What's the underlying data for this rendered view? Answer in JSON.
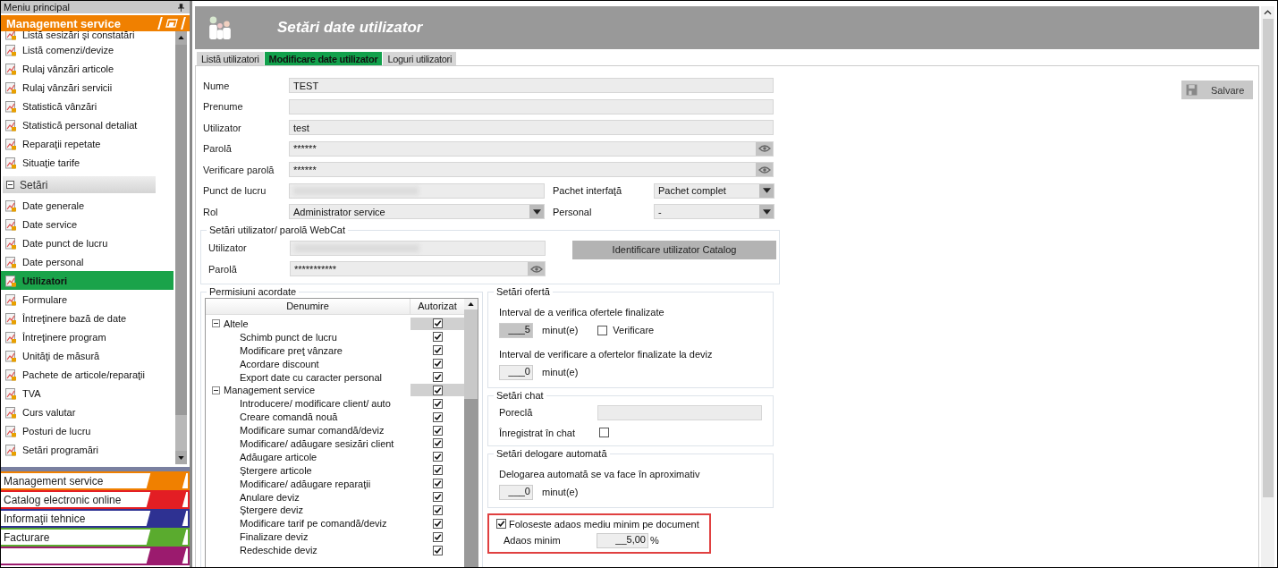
{
  "sidebar": {
    "title": "Meniu principal",
    "header": "Management service",
    "items": [
      {
        "label": "Listă sesizări şi constatări",
        "selected": false
      },
      {
        "label": "Listă comenzi/devize",
        "selected": false
      },
      {
        "label": "Rulaj vânzări articole",
        "selected": false
      },
      {
        "label": "Rulaj vânzări servicii",
        "selected": false
      },
      {
        "label": "Statistică vânzări",
        "selected": false
      },
      {
        "label": "Statistică personal detaliat",
        "selected": false
      },
      {
        "label": "Reparaţii repetate",
        "selected": false
      },
      {
        "label": "Situaţie tarife",
        "selected": false
      }
    ],
    "group": {
      "label": "Setări",
      "expanded": true
    },
    "group_items": [
      {
        "label": "Date generale",
        "selected": false
      },
      {
        "label": "Date service",
        "selected": false
      },
      {
        "label": "Date punct de lucru",
        "selected": false
      },
      {
        "label": "Date personal",
        "selected": false
      },
      {
        "label": "Utilizatori",
        "selected": true
      },
      {
        "label": "Formulare",
        "selected": false
      },
      {
        "label": "Întreţinere bază de date",
        "selected": false
      },
      {
        "label": "Întreţinere program",
        "selected": false
      },
      {
        "label": "Unităţi de măsură",
        "selected": false
      },
      {
        "label": "Pachete de articole/reparaţii",
        "selected": false
      },
      {
        "label": "TVA",
        "selected": false
      },
      {
        "label": "Curs valutar",
        "selected": false
      },
      {
        "label": "Posturi de lucru",
        "selected": false
      },
      {
        "label": "Setări programări",
        "selected": false
      }
    ],
    "nav_sections": [
      {
        "label": "Management service",
        "color": "#f08000"
      },
      {
        "label": "Catalog electronic online",
        "color": "#e31e24"
      },
      {
        "label": "Informaţii tehnice",
        "color": "#2e3192"
      },
      {
        "label": "Facturare",
        "color": "#5aab2e"
      },
      {
        "color": "#9b1b6e"
      }
    ]
  },
  "header": {
    "title": "Setări date utilizator"
  },
  "tabs": [
    {
      "label": "Listă utilizatori",
      "selected": false
    },
    {
      "label": "Modificare date utilizator",
      "selected": true
    },
    {
      "label": "Loguri utilizatori",
      "selected": false
    }
  ],
  "fields": [
    {
      "label": "Nume",
      "value": "TEST",
      "kind": "text"
    },
    {
      "label": "Prenume",
      "kind": "text"
    },
    {
      "label": "Utilizator",
      "value": "test",
      "kind": "text"
    },
    {
      "label": "Parolă",
      "value": "******",
      "kind": "password"
    },
    {
      "label": "Verificare parolă",
      "value": "******",
      "kind": "password"
    },
    {
      "label": "Punct de lucru",
      "kind": "blurred",
      "side": {
        "label": "Pachet interfaţă",
        "value": "Pachet complet"
      }
    },
    {
      "label": "Rol",
      "value": "Administrator service",
      "kind": "select",
      "side": {
        "label": "Personal",
        "value": "-"
      }
    }
  ],
  "webcat": {
    "title": "Setări utilizator/ parolă WebCat",
    "fields": [
      {
        "label": "Utilizator",
        "kind": "blurred"
      },
      {
        "label": "Parolă",
        "value": "***********",
        "kind": "password"
      }
    ],
    "button": "Identificare utilizator Catalog"
  },
  "permissions": {
    "title": "Permisiuni acordate",
    "columns": [
      "Denumire",
      "Autorizat"
    ],
    "rows": [
      {
        "label": "Altele",
        "expanded": true,
        "checked": true,
        "children": [
          {
            "label": "Schimb punct de lucru",
            "checked": true
          },
          {
            "label": "Modificare preţ vânzare",
            "checked": true
          },
          {
            "label": "Acordare discount",
            "checked": true
          },
          {
            "label": "Export date cu caracter personal",
            "checked": true
          }
        ]
      },
      {
        "label": "Management service",
        "expanded": true,
        "checked": true,
        "children": [
          {
            "label": "Introducere/ modificare client/ auto",
            "checked": true
          },
          {
            "label": "Creare comandă nouă",
            "checked": true
          },
          {
            "label": "Modificare sumar comandă/deviz",
            "checked": true
          },
          {
            "label": "Modificare/ adăugare sesizări client",
            "checked": true
          },
          {
            "label": "Adăugare articole",
            "checked": true
          },
          {
            "label": "Ştergere articole",
            "checked": true
          },
          {
            "label": "Modificare/ adăugare reparaţii",
            "checked": true
          },
          {
            "label": "Anulare deviz",
            "checked": true
          },
          {
            "label": "Ştergere deviz",
            "checked": true
          },
          {
            "label": "Modificare tarif pe comandă/deviz",
            "checked": true
          },
          {
            "label": "Finalizare deviz",
            "checked": true
          },
          {
            "label": "Redeschide deviz",
            "checked": true
          }
        ]
      }
    ]
  },
  "offer": {
    "title": "Setări ofertă",
    "intervals": [
      {
        "label": "Interval de a verifica ofertele finalizate",
        "value": "___5",
        "unit": "minut(e)",
        "disabled": true,
        "verify": {
          "label": "Verificare",
          "checked": false
        }
      },
      {
        "label": "Interval de verificare a ofertelor finalizate la deviz",
        "value": "___0",
        "unit": "minut(e)",
        "disabled": false
      }
    ]
  },
  "chat": {
    "title": "Setări chat",
    "nickname_label": "Poreclă",
    "registered": {
      "label": "Înregistrat în chat",
      "checked": false
    }
  },
  "logout": {
    "title": "Setări delogare automată",
    "label": "Delogarea automată se va face în aproximativ",
    "value": "___0",
    "unit": "minut(e)"
  },
  "markup": {
    "title": "Foloseste adaos mediu minim pe document",
    "checked": true,
    "label": "Adaos minim",
    "value": "__5,00",
    "unit": "%",
    "highlighted": true
  },
  "save_button": "Salvare"
}
